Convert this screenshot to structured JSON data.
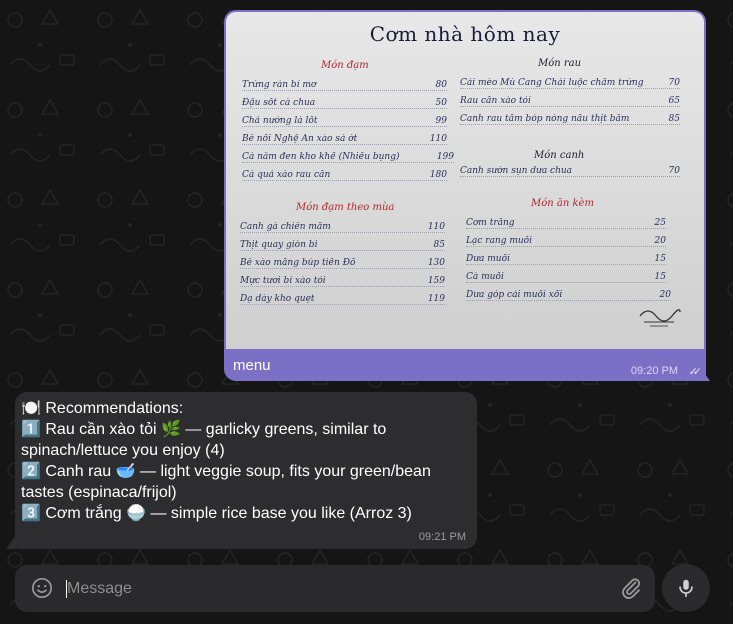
{
  "photo_message": {
    "menu": {
      "title": "Cơm nhà hôm nay",
      "sections": [
        {
          "heading": "Món đạm",
          "items": [
            {
              "name": "Trứng rán bí mơ",
              "price": "80"
            },
            {
              "name": "Đậu sốt cà chua",
              "price": "50"
            },
            {
              "name": "Chả nướng lá lốt",
              "price": "99"
            },
            {
              "name": "Bê nồi Nghệ An xào sả ớt",
              "price": "110"
            },
            {
              "name": "Cá nâm đen kho khế (Nhiều bụng)",
              "price": "199"
            },
            {
              "name": "Cá quả xào rau cần",
              "price": "180"
            }
          ]
        },
        {
          "heading": "Món đạm theo mùa",
          "items": [
            {
              "name": "Canh gà chiên mắm",
              "price": "110"
            },
            {
              "name": "Thịt quay giòn bì",
              "price": "85"
            },
            {
              "name": "Bê xào măng búp tiến Đồ",
              "price": "130"
            },
            {
              "name": "Mực tươi bí xào tỏi",
              "price": "159"
            },
            {
              "name": "Dạ dày kho quẹt",
              "price": "119"
            }
          ]
        },
        {
          "heading": "Món rau",
          "items": [
            {
              "name": "Cải mèo Mù Cang Chải luộc chấm trứng",
              "price": "70"
            },
            {
              "name": "Rau cần xào tỏi",
              "price": "65"
            },
            {
              "name": "Canh rau tầm bóp nóng nấu thịt bằm",
              "price": "85"
            }
          ]
        },
        {
          "heading": "Món canh",
          "items": [
            {
              "name": "Canh sườn sụn dưa chua",
              "price": "70"
            }
          ]
        },
        {
          "heading": "Món ăn kèm",
          "items": [
            {
              "name": "Cơm trắng",
              "price": "25"
            },
            {
              "name": "Lạc rang muối",
              "price": "20"
            },
            {
              "name": "Dưa muối",
              "price": "15"
            },
            {
              "name": "Cà muối",
              "price": "15"
            },
            {
              "name": "Dưa góp cải muối xổi",
              "price": "20"
            }
          ]
        }
      ]
    },
    "caption": "menu",
    "time": "09:20 PM",
    "read_ticks": "✓✓"
  },
  "reply_message": {
    "lines": [
      "🍽️ Recommendations:",
      "1️⃣ Rau cần xào tỏi 🌿 — garlicky greens, similar to spinach/lettuce you enjoy (4)",
      "2️⃣ Canh rau 🥣 — light veggie soup, fits your green/bean tastes (espinaca/frijol)",
      "3️⃣ Cơm trắng 🍚 — simple rice base you like (Arroz 3)"
    ],
    "time": "09:21 PM"
  },
  "composer": {
    "placeholder": "Message"
  },
  "colors": {
    "outgoing_bubble": "#7c6fc6",
    "incoming_bubble": "#2d2d2f",
    "background": "#151515",
    "menu_red": "#b3262e",
    "menu_ink": "#2a2f5e"
  },
  "icons": [
    "emoji-icon",
    "paperclip-icon",
    "microphone-icon",
    "double-check-icon"
  ]
}
